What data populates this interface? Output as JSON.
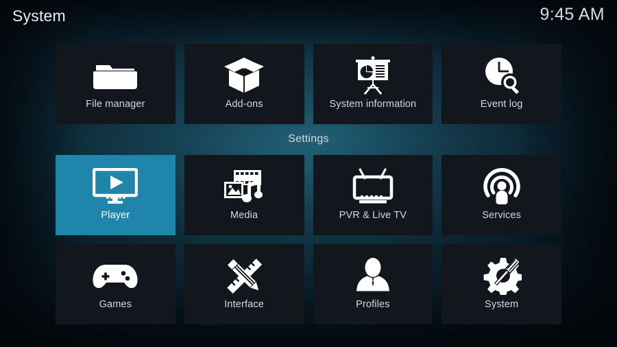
{
  "header": {
    "title": "System",
    "clock": "9:45 AM"
  },
  "theme": {
    "highlight_color": "#1f85ab",
    "tile_color": "#12161d",
    "text_color": "#d3dade",
    "background_color": "#0a2231"
  },
  "top_row": {
    "items": [
      {
        "label": "File manager",
        "icon": "folder-icon",
        "selected": false
      },
      {
        "label": "Add-ons",
        "icon": "open-box-icon",
        "selected": false
      },
      {
        "label": "System information",
        "icon": "presentation-board-icon",
        "selected": false
      },
      {
        "label": "Event log",
        "icon": "clock-search-icon",
        "selected": false
      }
    ]
  },
  "settings_section": {
    "title": "Settings",
    "rows": [
      {
        "items": [
          {
            "label": "Player",
            "icon": "monitor-play-icon",
            "selected": true
          },
          {
            "label": "Media",
            "icon": "film-photo-music-icon",
            "selected": false
          },
          {
            "label": "PVR & Live TV",
            "icon": "television-antenna-icon",
            "selected": false
          },
          {
            "label": "Services",
            "icon": "podcast-broadcast-icon",
            "selected": false
          }
        ]
      },
      {
        "items": [
          {
            "label": "Games",
            "icon": "gamepad-icon",
            "selected": false
          },
          {
            "label": "Interface",
            "icon": "pencil-ruler-icon",
            "selected": false
          },
          {
            "label": "Profiles",
            "icon": "person-bust-icon",
            "selected": false
          },
          {
            "label": "System",
            "icon": "gear-screwdriver-icon",
            "selected": false
          }
        ]
      }
    ]
  }
}
